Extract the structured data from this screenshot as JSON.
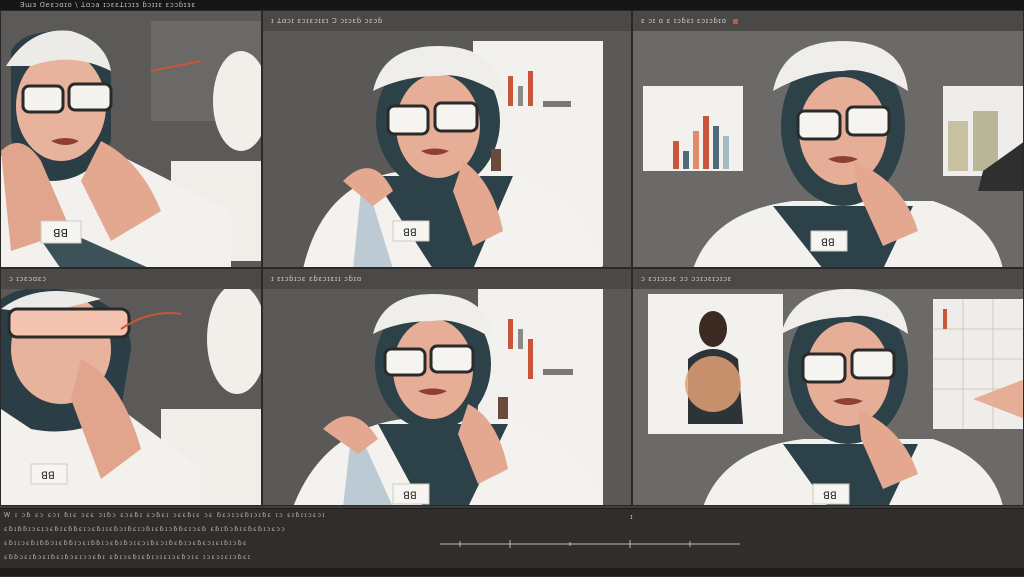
{
  "app": {
    "menu_text": "Ǝɯɜ ᗡeɛɔɑɪo \\ ꓕɑɔa ɪɔɛɛꓕɪɔɪɜ ɓɔɪɪɛ ɛɔɔɓɪɜɛ",
    "accent_color": "#c9553b",
    "background_color": "#3f3e3d"
  },
  "panels": [
    {
      "title": "",
      "kind": "closeup-glasses"
    },
    {
      "title": "ɪ ꓕɑɔɪ ɛɔɪɛɔɪɛɪ   Ɔ ɔɪɔɛɓ ɔɛɔɓ",
      "kind": "portrait-center"
    },
    {
      "title": "ɛ ɔɪ ɑ ɛ ɪɔɓɛɪ ɛɔɪɔɓɪɑ",
      "kind": "portrait-chart"
    },
    {
      "title": "ɔ ɪɔɛɔɑɛɔ",
      "kind": "closeup-hand"
    },
    {
      "title": "ɪ ɛɪɔɓɪɔɛ   ɛɓɛɔɪɛɪɪ ɔɓɪɑ",
      "kind": "portrait-pencil"
    },
    {
      "title": "ɔ ɛɔɪɔɪɔɛ ɔɔ ɔɔɪɔɛɪɔɪɔɛ",
      "kind": "portrait-figure"
    }
  ],
  "timeline": {
    "row1": "Ꮃ ɪ ɔɓ ɛɔ ɛɔɪ ɓɪɛ ɔɛɛ ɔɪɓɔ ɛɔɛɓɪ ɛɔɓɛɪ ɔɛɛɓɪɛ ɔɛ ɓɛɔɪɔɛɓɪɔɪɓɛ   ɪɔ ɛɪɓɪɪɔɛɔɪ",
    "row2": "ɛɓɪɓɓɪɔɛɪɔɛɓɪɛɓɓɛɪɔɛɓɪɪɛɓɔɪɓɛɪɔɓɪɛɓɪɔɓɓɛɪɔɛɓ ɛɓɪɓɔɓɪɛɓɛɓɪɔɛɔɔ",
    "row3": "ɛɓɪɪɔɛɓɪɓɓɔɪɛɓɓɪɔɛɪɓɓɪɔɛɓɪɓɔɪɛɔɪɓɛɔɪɓɛɓɪɔɛɓɛɔɪɛɪɓɪɔɓɛ",
    "row4": "ɛɓɓɔɛɪɓɔɛɪɓɛɪɓɔɛɪɔɔɛɓɪ   ɛɓɪɔɛɓɪɛɓɪɔɪɛɪɔɛɓɔɪɛ   ɪɔɛɔɪɛɪɔɓɛɪ",
    "marker": "ɪ"
  }
}
